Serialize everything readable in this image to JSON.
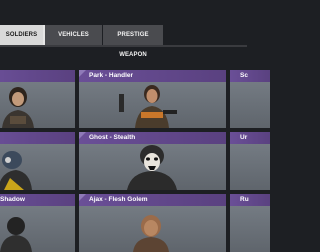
{
  "tabs": {
    "soldiers": "SOLDIERS",
    "vehicles": "VEHICLES",
    "prestige": "PRESTIGE WEAPON"
  },
  "cards": [
    {
      "name": ""
    },
    {
      "name": "Park - Handler"
    },
    {
      "name": "Sc"
    },
    {
      "name": ""
    },
    {
      "name": "Ghost - Stealth"
    },
    {
      "name": "Ur"
    },
    {
      "name": "Shadow"
    },
    {
      "name": "Ajax - Flesh Golem"
    },
    {
      "name": "Ru"
    }
  ],
  "colors": {
    "background": "#1d1f23",
    "active_tab": "#d9d9d9",
    "inactive_tab": "#4a4b4f",
    "card_header": "#6a4f97",
    "card_body": "#6e747b"
  }
}
